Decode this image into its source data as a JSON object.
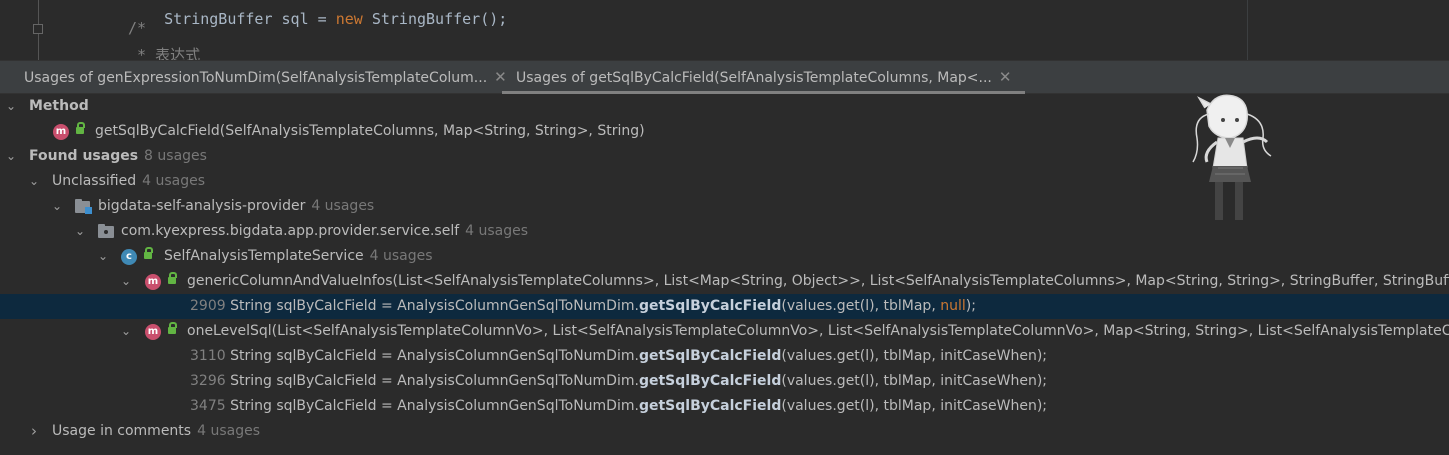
{
  "editor": {
    "line1": {
      "prefix": "StringBuffer sql = ",
      "kw": "new",
      "suffix": " StringBuffer();"
    },
    "line2": "/*",
    "line3": " * 表达式"
  },
  "tabs": [
    {
      "label": "Usages of genExpressionToNumDim(SelfAnalysisTemplateColum...",
      "close": "✕"
    },
    {
      "label": "Usages of getSqlByCalcField(SelfAnalysisTemplateColumns, Map<...",
      "close": "✕"
    }
  ],
  "tree": {
    "method": {
      "header": "Method",
      "signature": "getSqlByCalcField(SelfAnalysisTemplateColumns, Map<String, String>, String)"
    },
    "found": {
      "label": "Found usages",
      "count": "8 usages",
      "unclassified": {
        "label": "Unclassified",
        "count": "4 usages"
      },
      "module": {
        "label": "bigdata-self-analysis-provider",
        "count": "4 usages"
      },
      "package": {
        "label": "com.kyexpress.bigdata.app.provider.service.self",
        "count": "4 usages"
      },
      "class": {
        "label": "SelfAnalysisTemplateService",
        "count": "4 usages"
      },
      "method1": {
        "label": "genericColumnAndValueInfos(List<SelfAnalysisTemplateColumns>, List<Map<String, Object>>, List<SelfAnalysisTemplateColumns>, Map<String, String>, StringBuffer, StringBuffer, int, ...)",
        "usages": [
          {
            "line": "2909",
            "pre": "String sqlByCalcField = AnalysisColumnGenSqlToNumDim.",
            "hl": "getSqlByCalcField",
            "post": "(values.get(l), tblMap, ",
            "kw": "null",
            "end": ");"
          }
        ]
      },
      "method2": {
        "label": "oneLevelSql(List<SelfAnalysisTemplateColumnVo>, List<SelfAnalysisTemplateColumnVo>, List<SelfAnalysisTemplateColumnVo>, Map<String, String>, List<SelfAnalysisTemplateColumns>,",
        "usages": [
          {
            "line": "3110",
            "pre": "String sqlByCalcField = AnalysisColumnGenSqlToNumDim.",
            "hl": "getSqlByCalcField",
            "post": "(values.get(l), tblMap, initCaseWhen);"
          },
          {
            "line": "3296",
            "pre": "String sqlByCalcField = AnalysisColumnGenSqlToNumDim.",
            "hl": "getSqlByCalcField",
            "post": "(values.get(l), tblMap, initCaseWhen);"
          },
          {
            "line": "3475",
            "pre": "String sqlByCalcField = AnalysisColumnGenSqlToNumDim.",
            "hl": "getSqlByCalcField",
            "post": "(values.get(l), tblMap, initCaseWhen);"
          }
        ]
      }
    },
    "comments": {
      "label": "Usage in comments",
      "count": "4 usages"
    }
  },
  "icons": {
    "method": "m",
    "class": "c",
    "expanded": "⌄",
    "collapsed": "›"
  },
  "colors": {
    "selection": "#0d293e",
    "method_icon": "#c94f6d",
    "class_icon": "#3f89b5",
    "keyword": "#cc7832"
  }
}
